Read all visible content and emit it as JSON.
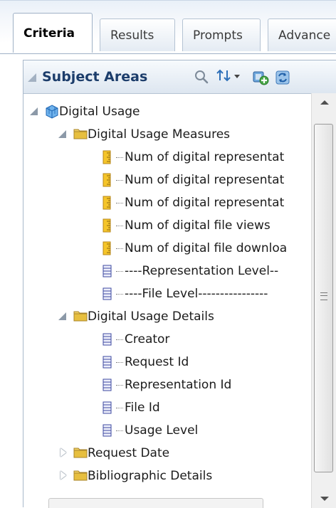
{
  "tabs": [
    {
      "label": "Criteria",
      "active": true
    },
    {
      "label": "Results",
      "active": false
    },
    {
      "label": "Prompts",
      "active": false
    },
    {
      "label": "Advance",
      "active": false
    }
  ],
  "panel": {
    "title": "Subject Areas",
    "icons": [
      "search-icon",
      "sort-dropdown-icon",
      "add-subject-area-icon",
      "refresh-icon"
    ]
  },
  "tree": {
    "root": {
      "label": "Digital Usage",
      "icon": "cube-icon",
      "expanded": true
    },
    "folders": [
      {
        "label": "Digital Usage Measures",
        "expanded": true,
        "items": [
          {
            "label": "Num of digital representat",
            "type": "measure"
          },
          {
            "label": "Num of digital representat",
            "type": "measure"
          },
          {
            "label": "Num of digital representat",
            "type": "measure"
          },
          {
            "label": "Num of digital file views",
            "type": "measure"
          },
          {
            "label": "Num of digital file downloa",
            "type": "measure"
          },
          {
            "label": "----Representation Level--",
            "type": "attribute"
          },
          {
            "label": "----File Level----------------",
            "type": "attribute"
          }
        ]
      },
      {
        "label": "Digital Usage Details",
        "expanded": true,
        "items": [
          {
            "label": "Creator",
            "type": "attribute"
          },
          {
            "label": "Request Id",
            "type": "attribute"
          },
          {
            "label": "Representation Id",
            "type": "attribute"
          },
          {
            "label": "File Id",
            "type": "attribute"
          },
          {
            "label": "Usage Level",
            "type": "attribute"
          }
        ]
      },
      {
        "label": "Request Date",
        "expanded": false,
        "items": []
      },
      {
        "label": "Bibliographic Details",
        "expanded": false,
        "items": []
      }
    ]
  },
  "colors": {
    "folder": "#e8c24a",
    "measure": "#f2c12e",
    "attribute": "#4a56a8",
    "cube": "#3b8fd6",
    "title": "#1c3d6b"
  }
}
